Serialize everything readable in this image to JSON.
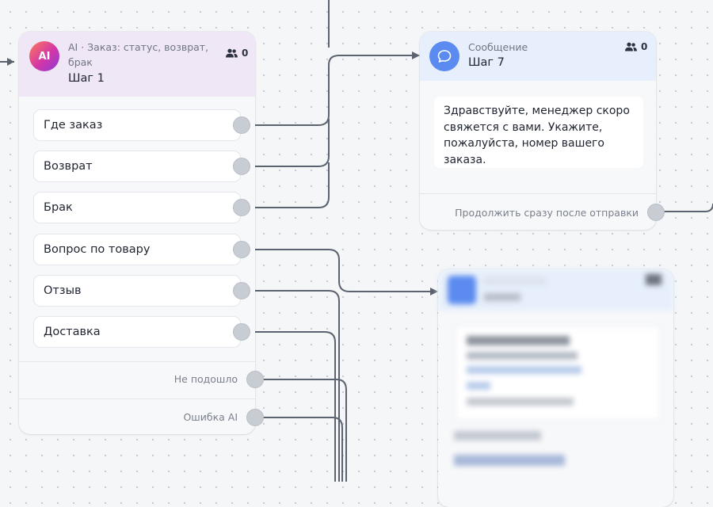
{
  "ai_node": {
    "avatar_text": "AI",
    "type_label": "AI · Заказ: статус, возврат, брак",
    "step": "Шаг 1",
    "users_count": "0",
    "options": [
      "Где заказ",
      "Возврат",
      "Брак",
      "Вопрос по товару",
      "Отзыв",
      "Доставка"
    ],
    "fallback_label": "Не подошло",
    "error_label": "Ошибка AI"
  },
  "message_node": {
    "type_label": "Сообщение",
    "step": "Шаг 7",
    "users_count": "0",
    "text": "Здравствуйте, менеджер скоро свяжется с вами. Укажите, пожалуйста, номер вашего заказа.",
    "continue_label": "Продолжить сразу после отправки"
  },
  "colors": {
    "wire": "#5b6270",
    "ai_header": "#efe6f6",
    "message_header": "#e6effb",
    "message_avatar": "#5b8bf0"
  }
}
